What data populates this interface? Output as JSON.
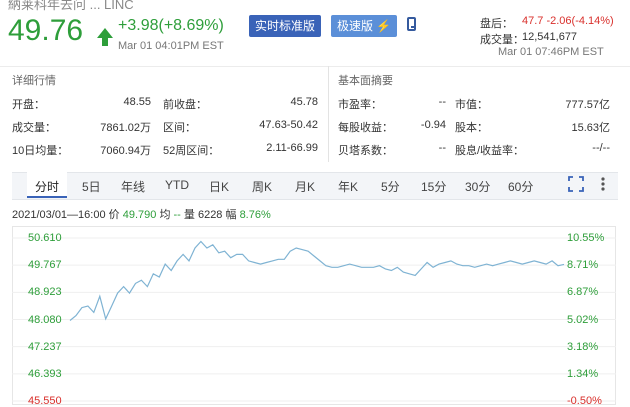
{
  "header": {
    "truncated_name": "納莱科年去问 ... LINC",
    "price": "49.76",
    "change": "+3.98(+8.69%)",
    "timestamp": "Mar 01 04:01PM EST",
    "btn_realtime": "实时标准版",
    "btn_fast": "极速版",
    "after_hours_label": "盘后：",
    "after_hours_value": "47.7 -2.06(-4.14%)",
    "volume_label": "成交量：",
    "volume_value": "12,541,677",
    "after_hours_time": "Mar 01 07:46PM EST"
  },
  "details": {
    "title": "详细行情",
    "rows": [
      [
        {
          "label": "开盘：",
          "value": "48.55"
        },
        {
          "label": "前收盘：",
          "value": "45.78"
        }
      ],
      [
        {
          "label": "成交量：",
          "value": "7861.02万"
        },
        {
          "label": "区间：",
          "value": "47.63-50.42"
        }
      ],
      [
        {
          "label": "10日均量：",
          "value": "7060.94万"
        },
        {
          "label": "52周区间：",
          "value": "2.11-66.99"
        }
      ]
    ]
  },
  "fundamentals": {
    "title": "基本面摘要",
    "rows": [
      [
        {
          "label": "市盈率：",
          "value": "--"
        },
        {
          "label": "市值：",
          "value": "777.57亿"
        }
      ],
      [
        {
          "label": "每股收益：",
          "value": "-0.94"
        },
        {
          "label": "股本：",
          "value": "15.63亿"
        }
      ],
      [
        {
          "label": "贝塔系数：",
          "value": "--"
        },
        {
          "label": "股息/收益率：",
          "value": "--/--"
        }
      ]
    ]
  },
  "tabs": [
    "分时",
    "5日",
    "年线",
    "YTD",
    "日K",
    "周K",
    "月K",
    "年K",
    "5分",
    "15分",
    "30分",
    "60分"
  ],
  "active_tab": "分时",
  "info": {
    "date": "2021/03/01—16:00",
    "price_label": "价",
    "price": "49.790",
    "avg_label": "均",
    "avg": "--",
    "vol_label": "量",
    "vol": "6228",
    "amp_label": "幅",
    "amp": "8.76%"
  },
  "chart_data": {
    "type": "line",
    "y_left_ticks": [
      "50.610",
      "49.767",
      "48.923",
      "48.080",
      "47.237",
      "46.393",
      "45.550"
    ],
    "y_right_ticks": [
      "10.55%",
      "8.71%",
      "6.87%",
      "5.02%",
      "3.18%",
      "1.34%",
      "-0.50%"
    ],
    "series": [
      {
        "values": [
          48.05,
          48.2,
          48.45,
          48.5,
          48.3,
          48.8,
          48.1,
          48.5,
          48.9,
          49.1,
          48.9,
          49.2,
          49.3,
          49.1,
          49.5,
          49.4,
          49.8,
          49.6,
          49.9,
          50.1,
          49.9,
          50.3,
          50.5,
          50.3,
          50.4,
          50.15,
          50.2,
          50.0,
          50.1,
          50.1,
          49.9,
          49.85,
          49.8,
          49.85,
          49.9,
          49.95,
          49.95,
          50.2,
          50.3,
          50.25,
          50.2,
          50.05,
          49.9,
          49.75,
          49.7,
          49.7,
          49.75,
          49.8,
          49.75,
          49.7,
          49.7,
          49.7,
          49.75,
          49.65,
          49.6,
          49.7,
          49.55,
          49.5,
          49.45,
          49.65,
          49.85,
          49.7,
          49.8,
          49.85,
          49.9,
          49.8,
          49.75,
          49.75,
          49.7,
          49.75,
          49.8,
          49.75,
          49.8,
          49.85,
          49.9,
          49.85,
          49.8,
          49.85,
          49.9,
          49.85,
          49.8,
          49.9,
          49.75,
          49.79
        ],
        "color": "#7fb3d3"
      }
    ],
    "ylim": [
      45.55,
      50.61
    ]
  }
}
